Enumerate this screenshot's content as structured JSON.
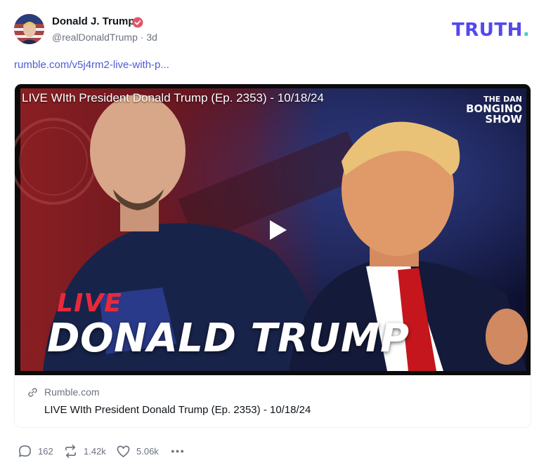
{
  "author": {
    "name": "Donald J. Trump",
    "handle": "@realDonaldTrump",
    "separator": "·",
    "time": "3d",
    "verified": true
  },
  "brand": {
    "logo_text": "TRUTH",
    "logo_dot": ".",
    "color": "#5448ee",
    "dot_color": "#3ad0c7"
  },
  "post": {
    "link_text": "rumble.com/v5j4rm2-live-with-p..."
  },
  "card": {
    "video_title": "LIVE WIth President Donald Trump (Ep. 2353) - 10/18/24",
    "badge_line1": "THE DAN",
    "badge_line2": "BONGINO",
    "badge_line3": "SHOW",
    "thumb_live": "LIVE",
    "thumb_headline": "DONALD TRUMP",
    "source": "Rumble.com",
    "title": "LIVE WIth President Donald Trump (Ep. 2353) - 10/18/24"
  },
  "actions": {
    "replies": "162",
    "retruths": "1.42k",
    "likes": "5.06k",
    "more_icon": "more-dots-icon"
  },
  "icons": [
    "verified-icon",
    "link-icon",
    "play-icon",
    "reply-icon",
    "retruth-icon",
    "like-icon",
    "more-dots-icon"
  ]
}
